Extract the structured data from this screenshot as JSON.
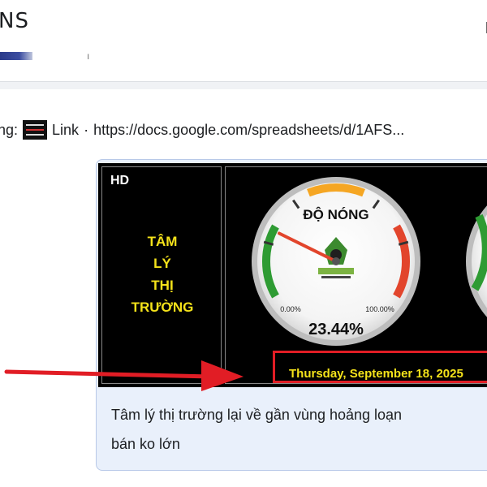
{
  "header": {
    "title": "NS",
    "close_glyph": "ı",
    "mark": "ı"
  },
  "post": {
    "link_prefix": "ng:",
    "link_label": "Link",
    "link_separator": "·",
    "link_url": "https://docs.google.com/spreadsheets/d/1AFS..."
  },
  "image": {
    "badge": "HD",
    "sentiment_lines": [
      "TÂM",
      "LÝ",
      "THỊ",
      "TRƯỜNG"
    ],
    "gauge": {
      "title": "ĐỘ NÓNG",
      "min_label": "0.00%",
      "max_label": "100.00%",
      "value_label": "23.44%",
      "value": 23.44
    },
    "date": "Thursday, September 18, 2025"
  },
  "caption": {
    "line1": "Tâm lý thị trường lại về gần vùng hoảng loạn",
    "line2": "bán ko lớn"
  },
  "colors": {
    "arrow": "#e11d25",
    "date_text": "#f4e21a",
    "gauge_green": "#2e9b33",
    "gauge_orange": "#f5a623",
    "gauge_red": "#e2452c",
    "card_bg": "#e9f0fb"
  }
}
